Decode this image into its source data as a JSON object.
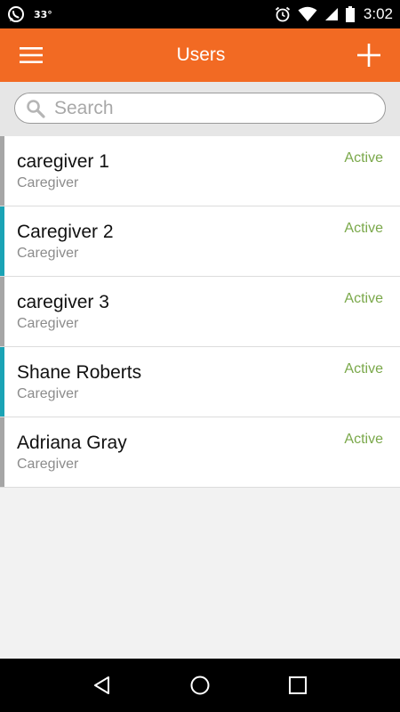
{
  "status_bar": {
    "temperature": "33°",
    "time": "3:02",
    "icons": [
      "whatsapp-icon",
      "alarm-icon",
      "wifi-icon",
      "signal-icon",
      "battery-icon"
    ]
  },
  "app_bar": {
    "title": "Users",
    "background": "#f26a23"
  },
  "search": {
    "placeholder": "Search",
    "value": ""
  },
  "users": [
    {
      "name": "caregiver 1",
      "role": "Caregiver",
      "status": "Active",
      "accent": "#a6a6a6"
    },
    {
      "name": "Caregiver 2",
      "role": "Caregiver",
      "status": "Active",
      "accent": "#1aa3b5"
    },
    {
      "name": "caregiver 3",
      "role": "Caregiver",
      "status": "Active",
      "accent": "#a6a6a6"
    },
    {
      "name": "Shane Roberts",
      "role": "Caregiver",
      "status": "Active",
      "accent": "#1aa3b5"
    },
    {
      "name": "Adriana Gray",
      "role": "Caregiver",
      "status": "Active",
      "accent": "#a6a6a6"
    }
  ],
  "colors": {
    "status_active": "#7aa84a"
  },
  "nav_bar": {
    "icons": [
      "back-icon",
      "home-icon",
      "recents-icon"
    ]
  }
}
